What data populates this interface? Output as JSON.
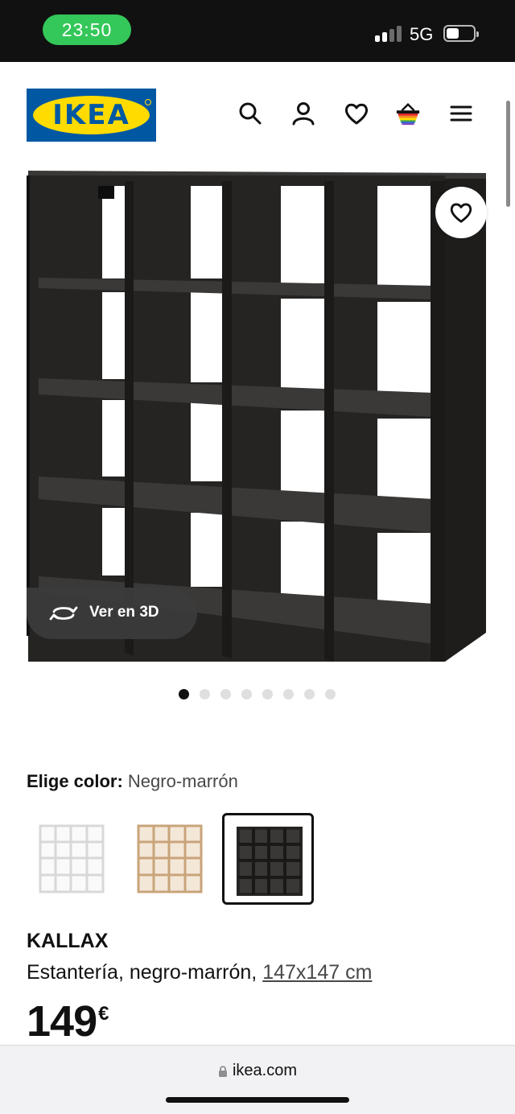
{
  "status_bar": {
    "time": "23:50",
    "network": "5G"
  },
  "header": {
    "logo_text": "IKEA",
    "icons": [
      "search-icon",
      "user-icon",
      "heart-icon",
      "basket-icon",
      "menu-icon"
    ]
  },
  "gallery": {
    "view_3d_label": "Ver en 3D",
    "dots_total": 8,
    "active_dot": 1
  },
  "color": {
    "label": "Elige color:",
    "selected_value": "Negro-marrón",
    "options": [
      {
        "name": "white",
        "hex": "#f5f5f5"
      },
      {
        "name": "oak",
        "hex": "#d9bc97"
      },
      {
        "name": "black-brown",
        "hex": "#262422"
      }
    ],
    "selected_index": 2
  },
  "product": {
    "name": "KALLAX",
    "description": "Estantería, negro-marrón,",
    "measurements": "147x147 cm",
    "price": "149",
    "currency": "€"
  },
  "browser": {
    "url": "ikea.com"
  },
  "colors": {
    "brand_blue": "#0058a3",
    "brand_yellow": "#ffdb00",
    "status_green": "#34c759"
  }
}
